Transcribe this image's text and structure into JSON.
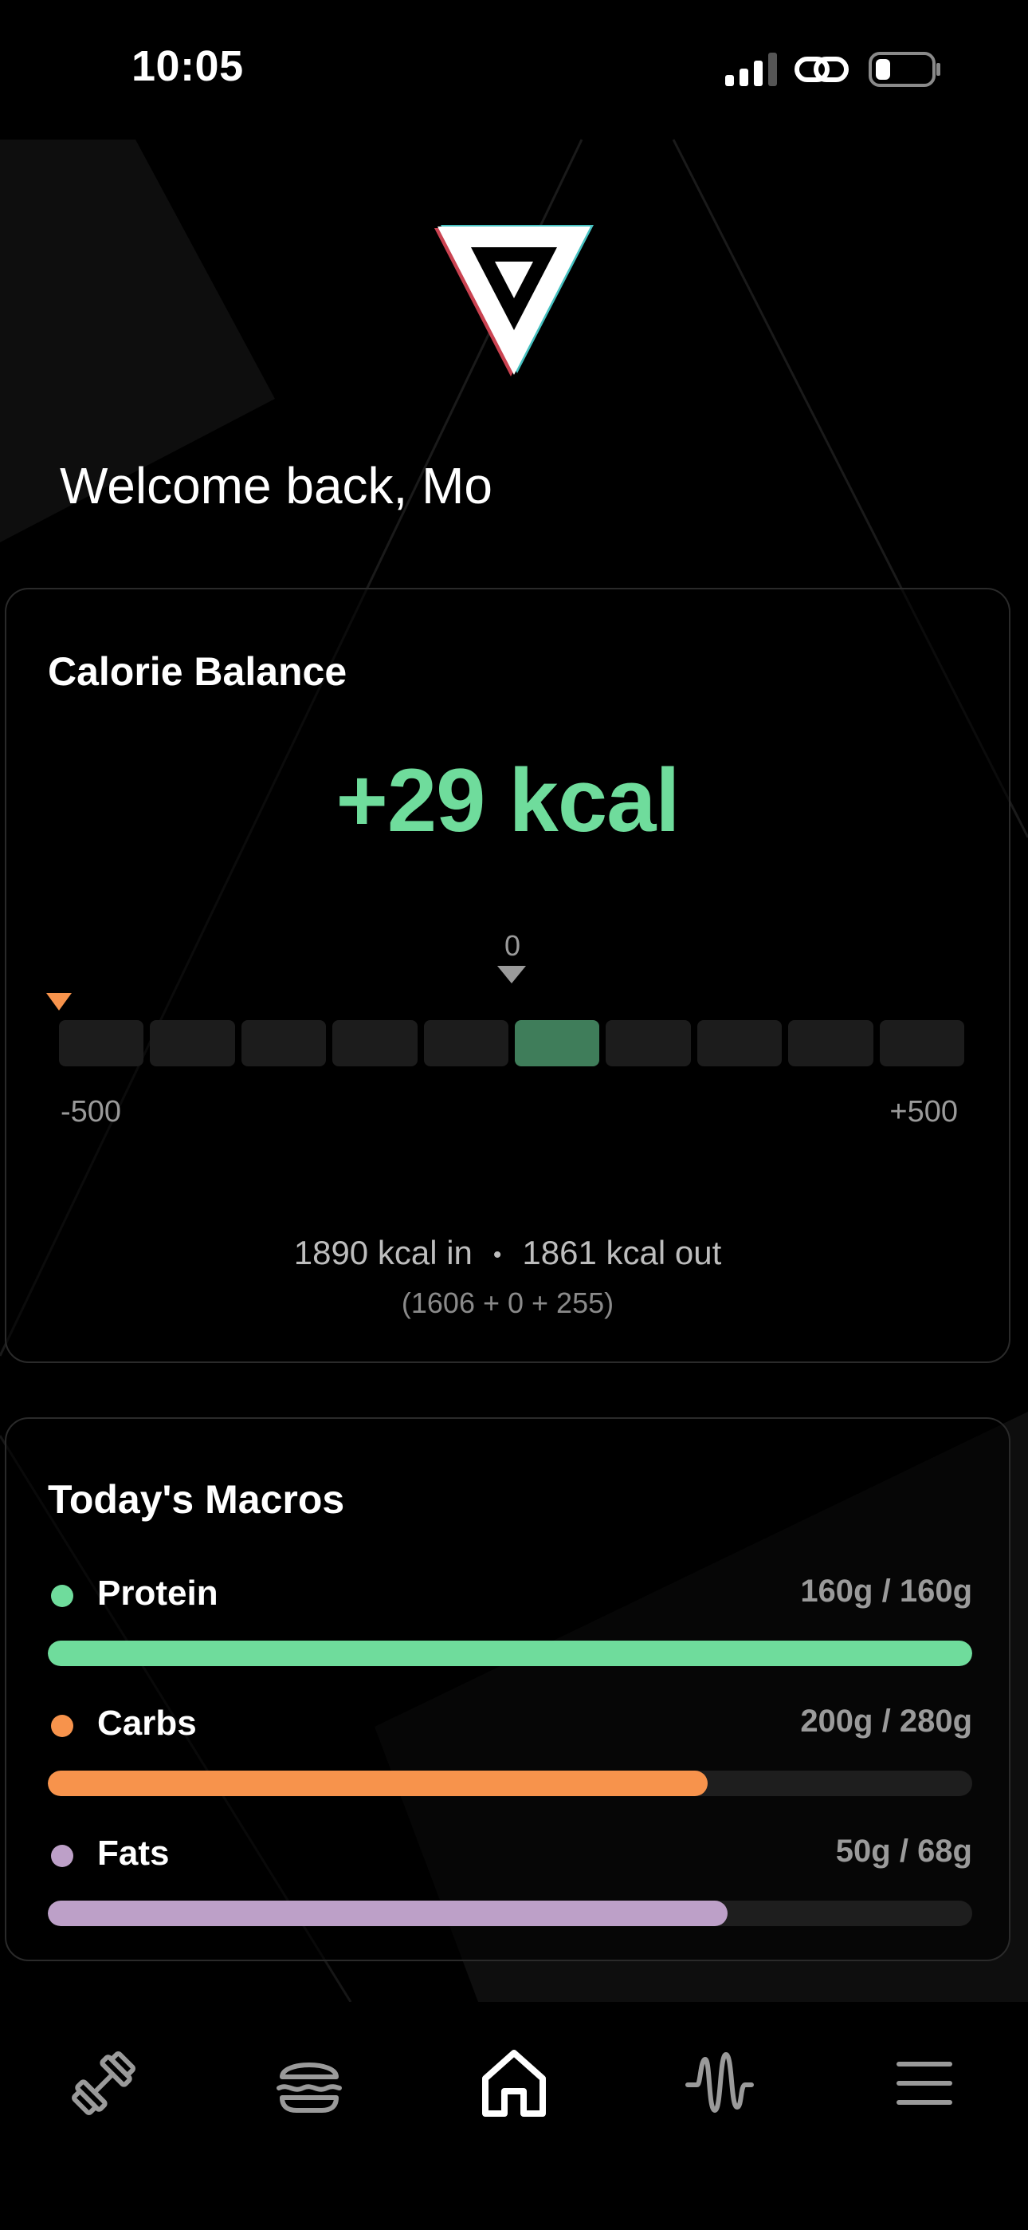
{
  "status_bar": {
    "time": "10:05",
    "icons": [
      "signal-icon",
      "link-icon",
      "battery-icon"
    ]
  },
  "welcome": "Welcome back, Mo",
  "calorie_balance": {
    "title": "Calorie Balance",
    "value": "+29 kcal",
    "zero_label": "0",
    "scale_min": "-500",
    "scale_max": "+500",
    "segments": 10,
    "active_segment": 6,
    "kcal_in": "1890 kcal in",
    "kcal_out": "1861 kcal out",
    "separator": "•",
    "breakdown": "(1606 + 0 + 255)",
    "accent_color": "#6fdc9c"
  },
  "macros": {
    "title": "Today's Macros",
    "items": [
      {
        "name": "Protein",
        "amount": "160g / 160g",
        "color": "#6fdc9c",
        "progress": 1.0
      },
      {
        "name": "Carbs",
        "amount": "200g / 280g",
        "color": "#f7934c",
        "progress": 0.714
      },
      {
        "name": "Fats",
        "amount": "50g / 68g",
        "color": "#bda0c8",
        "progress": 0.735
      }
    ]
  },
  "bottom_nav": {
    "items": [
      "dumbbell-icon",
      "burger-icon",
      "home-icon",
      "activity-icon",
      "menu-icon"
    ],
    "active": "home-icon"
  }
}
